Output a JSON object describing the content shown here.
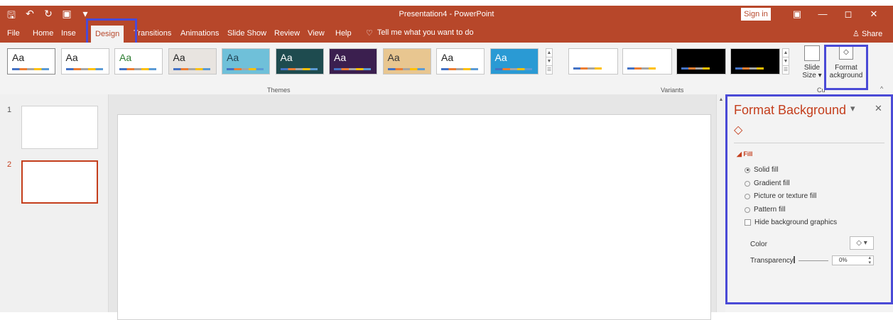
{
  "window": {
    "title": "Presentation4  -  PowerPoint",
    "sign_in": "Sign in"
  },
  "qat": {
    "save": "🖫",
    "undo": "↶",
    "redo": "↻",
    "present": "▣",
    "more": "▾"
  },
  "window_controls": {
    "restore_ribbon": "▣",
    "minimize": "—",
    "maximize": "◻",
    "close": "✕"
  },
  "tabs": [
    "File",
    "Home",
    "Inse",
    "Design",
    "Transitions",
    "Animations",
    "Slide Show",
    "Review",
    "View",
    "Help"
  ],
  "active_tab": "Design",
  "tell_me": "Tell me what you want to do",
  "share": "Share",
  "themes": {
    "label": "Themes",
    "items": [
      {
        "text": "Aa",
        "bg": "#ffffff",
        "fg": "#222222"
      },
      {
        "text": "Aa",
        "bg": "#ffffff",
        "fg": "#222222"
      },
      {
        "text": "Aa",
        "bg": "#ffffff",
        "fg": "#2e7d32"
      },
      {
        "text": "Aa",
        "bg": "#e8e4e0",
        "fg": "#222222"
      },
      {
        "text": "Aa",
        "bg": "#6fc0d9",
        "fg": "#224455"
      },
      {
        "text": "Aa",
        "bg": "#1e4b4f",
        "fg": "#ffffff"
      },
      {
        "text": "Aa",
        "bg": "#3b1f4f",
        "fg": "#ffffff"
      },
      {
        "text": "Aa",
        "bg": "#e8c690",
        "fg": "#333333"
      },
      {
        "text": "Aa",
        "bg": "#ffffff",
        "fg": "#222222"
      },
      {
        "text": "Aa",
        "bg": "#2a9ad4",
        "fg": "#ffffff"
      }
    ]
  },
  "variants": {
    "label": "Variants",
    "items": [
      {
        "bg": "#ffffff"
      },
      {
        "bg": "#ffffff"
      },
      {
        "bg": "#000000"
      },
      {
        "bg": "#000000"
      }
    ]
  },
  "customize": {
    "label": "Cu",
    "slide_size": [
      "Slide",
      "Size ▾"
    ],
    "format_background": [
      "Format",
      "ackground"
    ]
  },
  "slides": [
    {
      "number": "1"
    },
    {
      "number": "2"
    }
  ],
  "pane": {
    "title": "Format Background",
    "dropdown": "▾",
    "close": "✕",
    "fill_icon": "◇",
    "section": "◢ Fill",
    "options": [
      {
        "label": "Solid fill",
        "checked": true
      },
      {
        "label": "Gradient fill",
        "checked": false
      },
      {
        "label": "Picture or texture fill",
        "checked": false
      },
      {
        "label": "Pattern fill",
        "checked": false
      }
    ],
    "hide_graphics": "Hide background graphics",
    "color_label": "Color",
    "color_btn": "◇ ▾",
    "transparency_label": "Transparency",
    "transparency_value": "0%"
  },
  "colors": {
    "accent": "#b7472a",
    "highlight": "#4a4ad6"
  }
}
